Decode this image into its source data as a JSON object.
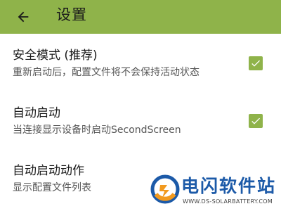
{
  "toolbar": {
    "title": "设置",
    "back_icon": "arrow-left-icon",
    "background_color": "#8fb34a"
  },
  "settings": [
    {
      "title": "安全模式 (推荐)",
      "subtitle": "重新启动后，配置文件将不会保持活动状态",
      "checked": true
    },
    {
      "title": "自动启动",
      "subtitle": "当连接显示设备时启动SecondScreen",
      "checked": true
    },
    {
      "title": "自动启动动作",
      "subtitle": "显示配置文件列表"
    }
  ],
  "checkbox_color": "#8fb34a",
  "watermark": {
    "name": "电闪软件站",
    "url": "WWW.DS-SOLARBATTERY.COM"
  }
}
